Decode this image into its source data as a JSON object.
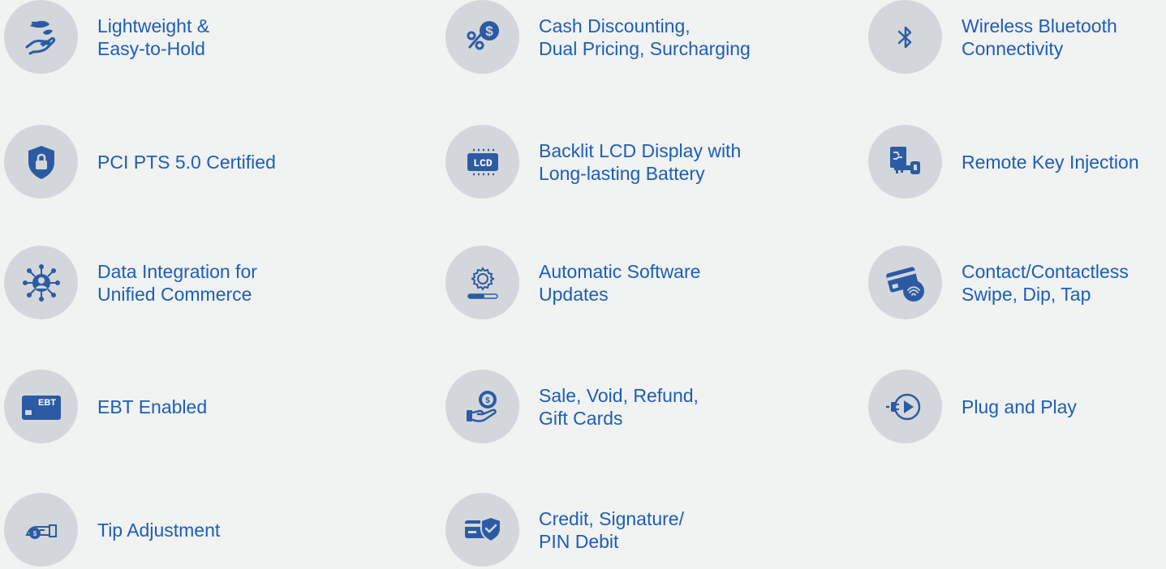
{
  "theme": {
    "background": "#f1f2f2",
    "circle": "#d3d7db",
    "icon": "#2c5ba4",
    "text": "#1c5fb5"
  },
  "features": [
    {
      "icon": "hand-holding-icon",
      "lines": [
        "Lightweight &",
        "Easy-to-Hold"
      ]
    },
    {
      "icon": "percent-dollar-icon",
      "lines": [
        "Cash Discounting,",
        "Dual Pricing, Surcharging"
      ]
    },
    {
      "icon": "bluetooth-icon",
      "lines": [
        "Wireless Bluetooth",
        "Connectivity"
      ]
    },
    {
      "icon": "shield-lock-icon",
      "lines": [
        "PCI PTS 5.0 Certified"
      ]
    },
    {
      "icon": "lcd-display-icon",
      "lines": [
        "Backlit LCD Display with",
        "Long-lasting Battery"
      ]
    },
    {
      "icon": "key-injection-icon",
      "lines": [
        "Remote Key Injection"
      ]
    },
    {
      "icon": "user-network-icon",
      "lines": [
        "Data Integration for",
        "Unified Commerce"
      ]
    },
    {
      "icon": "gear-update-icon",
      "lines": [
        "Automatic Software",
        "Updates"
      ]
    },
    {
      "icon": "contactless-card-icon",
      "lines": [
        "Contact/Contactless",
        "Swipe, Dip, Tap"
      ]
    },
    {
      "icon": "ebt-card-icon",
      "icon_text": "EBT",
      "lines": [
        "EBT Enabled"
      ]
    },
    {
      "icon": "hand-coin-icon",
      "lines": [
        "Sale, Void, Refund,",
        "Gift Cards"
      ]
    },
    {
      "icon": "plug-play-icon",
      "lines": [
        "Plug and Play"
      ]
    },
    {
      "icon": "hand-cash-icon",
      "lines": [
        "Tip Adjustment"
      ]
    },
    {
      "icon": "card-shield-icon",
      "lines": [
        "Credit, Signature/",
        "PIN Debit"
      ]
    }
  ]
}
